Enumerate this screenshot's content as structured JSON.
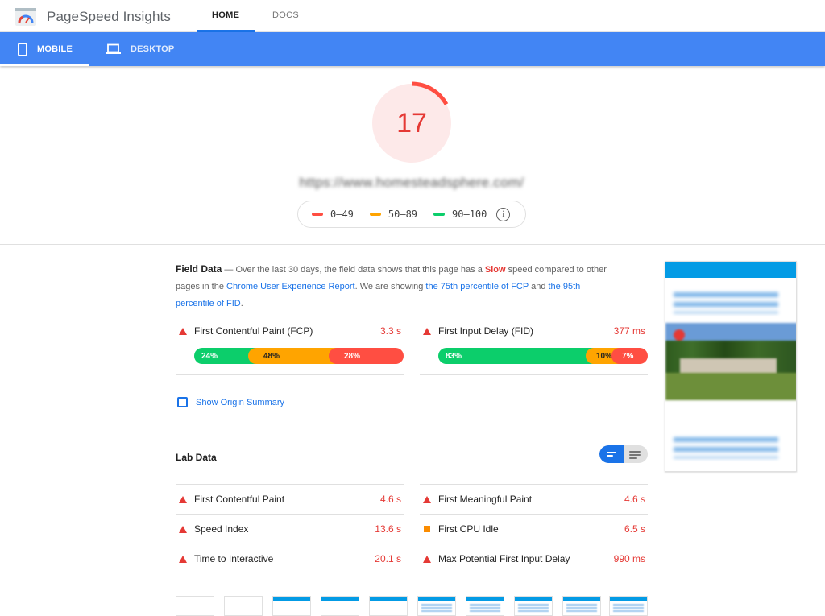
{
  "app": {
    "title": "PageSpeed Insights",
    "nav": {
      "home": "HOME",
      "docs": "DOCS"
    }
  },
  "device_tabs": {
    "mobile": "MOBILE",
    "desktop": "DESKTOP"
  },
  "score": {
    "value": "17",
    "fraction": 0.17,
    "color": "#ff4e42"
  },
  "site_url": "https://www.homesteadsphere.com/",
  "legend": {
    "low": "0–49",
    "mid": "50–89",
    "high": "90–100"
  },
  "field_data": {
    "heading": "Field Data",
    "text_1": " — Over the last 30 days, the field data shows that this page has a ",
    "slow": "Slow",
    "text_2": " speed compared to other pages in the ",
    "link_cux": "Chrome User Experience Report",
    "text_3": ". We are showing ",
    "link_fcp": "the 75th percentile of FCP",
    "text_4": " and ",
    "link_fid": "the 95th percentile of FID",
    "text_5": ".",
    "fcp": {
      "label": "First Contentful Paint (FCP)",
      "value": "3.3 s",
      "fast": "24%",
      "average": "48%",
      "slow": "28%",
      "fast_pct": 24,
      "average_pct": 48,
      "slow_pct": 28
    },
    "fid": {
      "label": "First Input Delay (FID)",
      "value": "377 ms",
      "fast": "83%",
      "average": "10%",
      "slow": "7%",
      "fast_pct": 83,
      "average_pct": 10,
      "slow_pct": 7
    }
  },
  "origin_summary": "Show Origin Summary",
  "lab_data": {
    "heading": "Lab Data",
    "left": [
      {
        "label": "First Contentful Paint",
        "value": "4.6 s",
        "status": "fail"
      },
      {
        "label": "Speed Index",
        "value": "13.6 s",
        "status": "fail"
      },
      {
        "label": "Time to Interactive",
        "value": "20.1 s",
        "status": "fail"
      }
    ],
    "right": [
      {
        "label": "First Meaningful Paint",
        "value": "4.6 s",
        "status": "fail"
      },
      {
        "label": "First CPU Idle",
        "value": "6.5 s",
        "status": "average"
      },
      {
        "label": "Max Potential First Input Delay",
        "value": "990 ms",
        "status": "fail"
      }
    ]
  },
  "colors": {
    "accent": "#1a73e8",
    "bar": "#4285f4",
    "fail": "#e53935",
    "average": "#fb8c00",
    "pass": "#0cce6b"
  }
}
